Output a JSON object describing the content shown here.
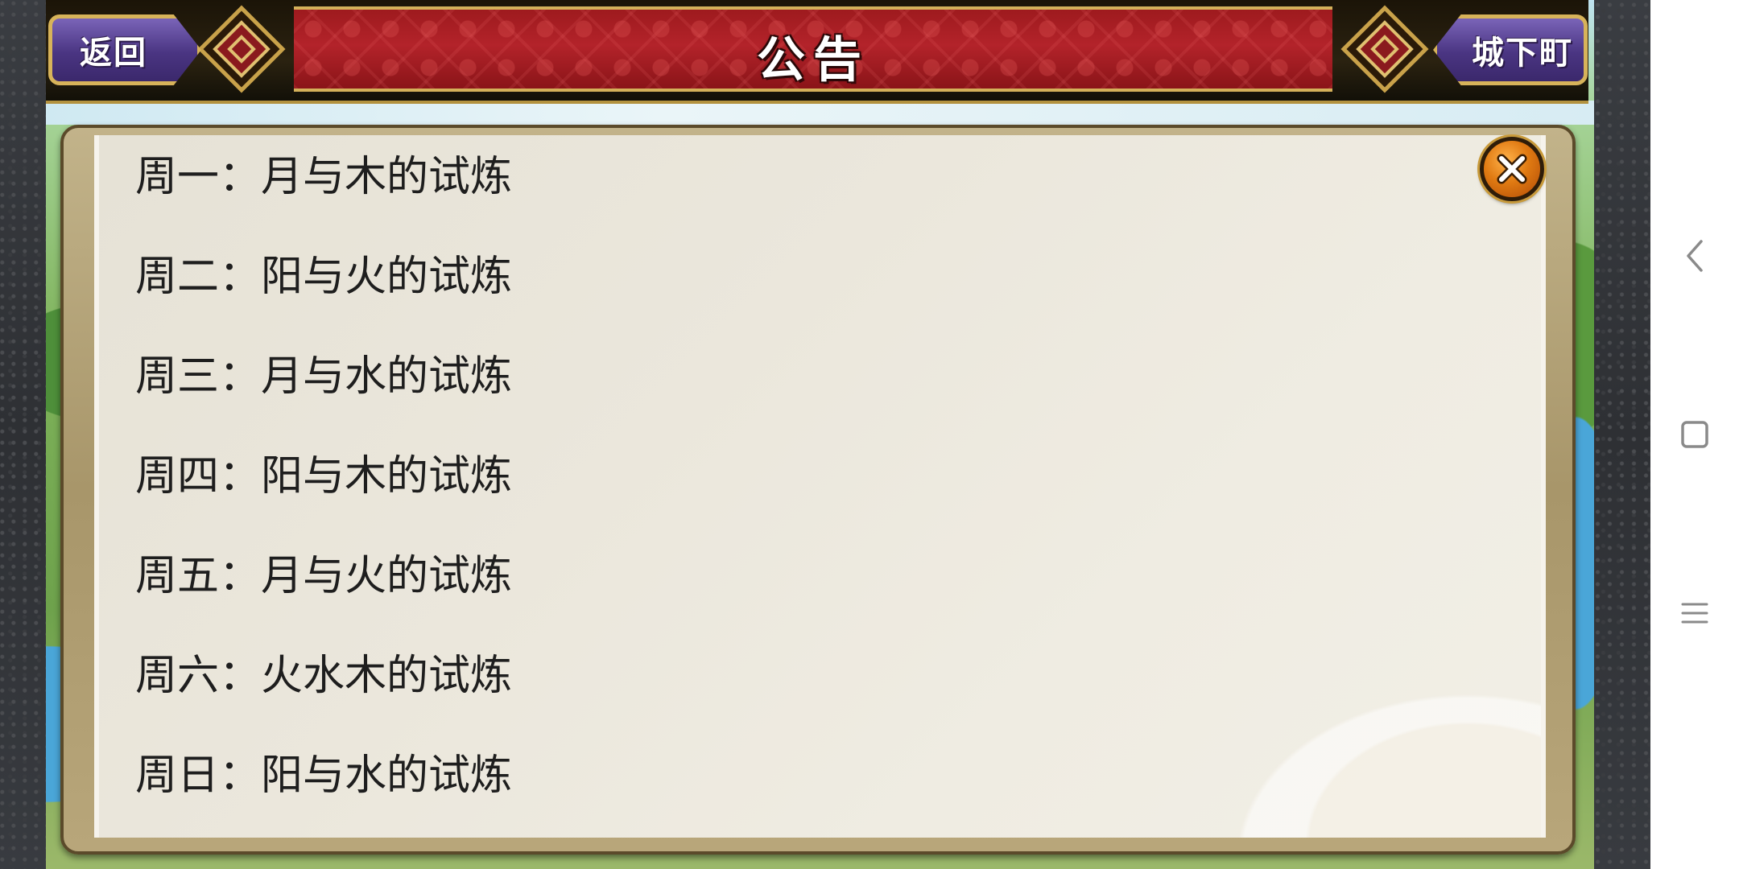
{
  "header": {
    "title": "公告",
    "back_label": "返回",
    "town_label": "城下町"
  },
  "announcement": {
    "items": [
      "周一：月与木的试炼",
      "周二：阳与火的试炼",
      "周三：月与水的试炼",
      "周四：阳与木的试炼",
      "周五：月与火的试炼",
      "周六：火水木的试炼",
      "周日：阳与水的试炼"
    ]
  },
  "icons": {
    "close": "close-icon",
    "nav_back": "chevron-left-icon",
    "nav_home": "square-icon",
    "nav_menu": "menu-icon"
  },
  "colors": {
    "banner_red": "#9e1a1e",
    "button_purple": "#4a3582",
    "frame_gold": "#d7b35a",
    "close_orange": "#e07a12"
  }
}
